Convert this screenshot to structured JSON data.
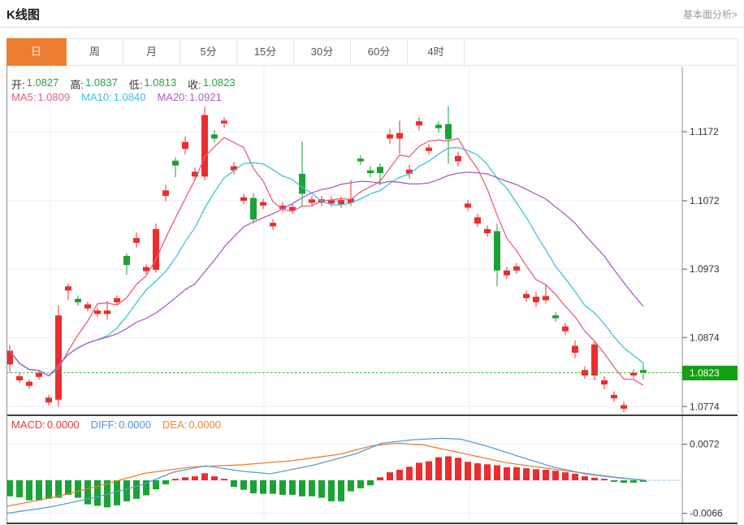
{
  "header": {
    "title": "K线图",
    "link": "基本面分析>"
  },
  "tabs": [
    {
      "label": "日",
      "active": true
    },
    {
      "label": "周",
      "active": false
    },
    {
      "label": "月",
      "active": false
    },
    {
      "label": "5分",
      "active": false
    },
    {
      "label": "15分",
      "active": false
    },
    {
      "label": "30分",
      "active": false
    },
    {
      "label": "60分",
      "active": false
    },
    {
      "label": "4时",
      "active": false
    }
  ],
  "ohlc": {
    "open_label": "开:",
    "open": "1.0827",
    "high_label": "高:",
    "high": "1.0837",
    "low_label": "低:",
    "low": "1.0813",
    "close_label": "收:",
    "close": "1.0823"
  },
  "ma": {
    "ma5_label": "MA5:",
    "ma5": "1.0809",
    "ma10_label": "MA10:",
    "ma10": "1.0840",
    "ma20_label": "MA20:",
    "ma20": "1.0921"
  },
  "macd_info": {
    "macd_label": "MACD:",
    "macd": "0.0000",
    "diff_label": "DIFF:",
    "diff": "0.0000",
    "dea_label": "DEA:",
    "dea": "0.0000"
  },
  "chart_data": {
    "type": "candlestick_with_macd",
    "title": "K线图",
    "period_selected": "日",
    "colors": {
      "up": "#ec2d2d",
      "down": "#1aa334",
      "ma5": "#e5607a",
      "ma10": "#3bc4da",
      "ma20": "#a95fc4",
      "diff_line": "#5b9bd5",
      "dea_line": "#ed7d31",
      "last_price_line": "#2fae2f",
      "badge_bg": "#13a113",
      "accent_tab": "#ee7e32"
    },
    "y_axis_labels": [
      "1.1172",
      "1.1072",
      "1.0973",
      "1.0874",
      "1.0774"
    ],
    "last_price": 1.0823,
    "last_price_label": "1.0823",
    "ma_periods": [
      5,
      10,
      20
    ],
    "candles": [
      [
        1.0835,
        1.0863,
        1.0823,
        1.0855
      ],
      [
        1.0812,
        1.0822,
        1.0808,
        1.0818
      ],
      [
        1.0804,
        1.0813,
        1.08,
        1.081
      ],
      [
        1.0817,
        1.0826,
        1.0813,
        1.0823
      ],
      [
        1.078,
        1.0791,
        1.0776,
        1.0787
      ],
      [
        1.0784,
        1.0921,
        1.0774,
        1.0906
      ],
      [
        1.0942,
        1.0952,
        1.0928,
        1.0948
      ],
      [
        1.093,
        1.0935,
        1.092,
        1.0925
      ],
      [
        1.0916,
        1.0926,
        1.0912,
        1.0922
      ],
      [
        1.0908,
        1.0917,
        1.0904,
        1.0913
      ],
      [
        1.0908,
        1.0927,
        1.09,
        1.0913
      ],
      [
        1.0925,
        1.0935,
        1.0921,
        1.0931
      ],
      [
        1.0992,
        1.0996,
        1.0965,
        1.0979
      ],
      [
        1.1011,
        1.1026,
        1.1004,
        1.1018
      ],
      [
        1.097,
        1.098,
        1.0966,
        1.0976
      ],
      [
        1.0972,
        1.1039,
        1.0968,
        1.1031
      ],
      [
        1.1079,
        1.1095,
        1.1071,
        1.1087
      ],
      [
        1.113,
        1.1135,
        1.1106,
        1.1123
      ],
      [
        1.1147,
        1.1165,
        1.1139,
        1.1157
      ],
      [
        1.1107,
        1.112,
        1.1101,
        1.1114
      ],
      [
        1.1107,
        1.1208,
        1.1101,
        1.1196
      ],
      [
        1.1168,
        1.1174,
        1.1156,
        1.1162
      ],
      [
        1.1184,
        1.1193,
        1.1177,
        1.1188
      ],
      [
        1.1116,
        1.1128,
        1.111,
        1.1122
      ],
      [
        1.1072,
        1.1082,
        1.1067,
        1.1077
      ],
      [
        1.1076,
        1.1083,
        1.1039,
        1.1045
      ],
      [
        1.1065,
        1.1075,
        1.106,
        1.107
      ],
      [
        1.1035,
        1.1045,
        1.103,
        1.104
      ],
      [
        1.106,
        1.107,
        1.1055,
        1.1065
      ],
      [
        1.1058,
        1.1068,
        1.1053,
        1.1063
      ],
      [
        1.1111,
        1.1158,
        1.1064,
        1.1082
      ],
      [
        1.1069,
        1.1079,
        1.1064,
        1.1074
      ],
      [
        1.1069,
        1.1079,
        1.1064,
        1.1074
      ],
      [
        1.1068,
        1.1078,
        1.1063,
        1.1073
      ],
      [
        1.1067,
        1.1078,
        1.1062,
        1.1073
      ],
      [
        1.1069,
        1.1102,
        1.1065,
        1.1075
      ],
      [
        1.1133,
        1.1138,
        1.1124,
        1.1129
      ],
      [
        1.1116,
        1.1122,
        1.1106,
        1.1112
      ],
      [
        1.1121,
        1.1126,
        1.1094,
        1.1112
      ],
      [
        1.1162,
        1.1176,
        1.1155,
        1.1168
      ],
      [
        1.1162,
        1.1188,
        1.114,
        1.117
      ],
      [
        1.1111,
        1.1124,
        1.1104,
        1.1117
      ],
      [
        1.1181,
        1.1193,
        1.1174,
        1.1187
      ],
      [
        1.1144,
        1.1154,
        1.1139,
        1.1149
      ],
      [
        1.1182,
        1.1187,
        1.1171,
        1.1177
      ],
      [
        1.1183,
        1.1209,
        1.1125,
        1.1161
      ],
      [
        1.1129,
        1.1143,
        1.1122,
        1.1137
      ],
      [
        1.1062,
        1.1073,
        1.1057,
        1.1068
      ],
      [
        1.1039,
        1.1053,
        1.1034,
        1.1048
      ],
      [
        1.1025,
        1.1036,
        1.102,
        1.1031
      ],
      [
        1.1028,
        1.1039,
        1.0948,
        1.0971
      ],
      [
        1.0964,
        1.0976,
        1.0959,
        1.0971
      ],
      [
        1.0971,
        1.0982,
        1.0966,
        1.0977
      ],
      [
        1.0931,
        1.0942,
        1.0926,
        1.0937
      ],
      [
        1.0925,
        1.094,
        1.0918,
        1.0933
      ],
      [
        1.0928,
        1.095,
        1.0923,
        1.0934
      ],
      [
        1.0906,
        1.0911,
        1.0897,
        1.0902
      ],
      [
        1.0883,
        1.0895,
        1.0878,
        1.089
      ],
      [
        1.0852,
        1.087,
        1.0844,
        1.0862
      ],
      [
        1.0819,
        1.0832,
        1.0814,
        1.0827
      ],
      [
        1.0819,
        1.0869,
        1.0812,
        1.0864
      ],
      [
        1.0806,
        1.0818,
        1.0799,
        1.0812
      ],
      [
        1.0786,
        1.0796,
        1.0781,
        1.0791
      ],
      [
        1.0771,
        1.0781,
        1.0766,
        1.0776
      ],
      [
        1.0819,
        1.0828,
        1.0815,
        1.0823
      ],
      [
        1.0827,
        1.0837,
        1.0813,
        1.0823
      ]
    ],
    "macd": {
      "y_axis_labels": [
        "0.0072",
        "-0.0066"
      ],
      "histogram": [
        -0.0032,
        -0.0034,
        -0.004,
        -0.004,
        -0.0037,
        -0.0035,
        -0.0029,
        -0.0035,
        -0.0048,
        -0.0051,
        -0.0054,
        -0.005,
        -0.0042,
        -0.0037,
        -0.003,
        -0.0018,
        -0.0008,
        0.0003,
        0.0006,
        0.0008,
        0.0014,
        0.0008,
        0.0003,
        -0.0013,
        -0.0019,
        -0.0026,
        -0.0027,
        -0.0027,
        -0.0029,
        -0.0029,
        -0.0032,
        -0.0032,
        -0.0035,
        -0.0042,
        -0.0042,
        -0.0022,
        -0.0016,
        -0.001,
        0.0006,
        0.0016,
        0.0021,
        0.0027,
        0.0035,
        0.0038,
        0.0046,
        0.0048,
        0.0045,
        0.0037,
        0.0034,
        0.0032,
        0.003,
        0.0026,
        0.0026,
        0.0024,
        0.0022,
        0.0021,
        0.0019,
        0.0016,
        0.0013,
        0.0008,
        0.0005,
        0.0003,
        -0.0003,
        -0.0005,
        -0.0005,
        -0.0003
      ],
      "diff_points": [
        [
          0,
          -0.0066
        ],
        [
          55,
          -0.0053
        ],
        [
          110,
          -0.0034
        ],
        [
          165,
          -0.001
        ],
        [
          205,
          0.0016
        ],
        [
          245,
          0.0029
        ],
        [
          290,
          0.0018
        ],
        [
          325,
          0.0013
        ],
        [
          380,
          0.0031
        ],
        [
          430,
          0.0053
        ],
        [
          462,
          0.0074
        ],
        [
          500,
          0.0081
        ],
        [
          537,
          0.0084
        ],
        [
          560,
          0.0082
        ],
        [
          592,
          0.0068
        ],
        [
          632,
          0.0047
        ],
        [
          672,
          0.0027
        ],
        [
          712,
          0.0013
        ],
        [
          752,
          0.0005
        ],
        [
          787,
          0.0
        ]
      ],
      "dea_points": [
        [
          0,
          -0.0052
        ],
        [
          55,
          -0.0035
        ],
        [
          110,
          -0.0013
        ],
        [
          170,
          0.0014
        ],
        [
          230,
          0.0027
        ],
        [
          290,
          0.0031
        ],
        [
          350,
          0.0039
        ],
        [
          410,
          0.0052
        ],
        [
          450,
          0.0069
        ],
        [
          482,
          0.0074
        ],
        [
          512,
          0.0071
        ],
        [
          550,
          0.0058
        ],
        [
          615,
          0.0035
        ],
        [
          680,
          0.0021
        ],
        [
          750,
          0.0006
        ],
        [
          787,
          0.0
        ]
      ]
    }
  }
}
